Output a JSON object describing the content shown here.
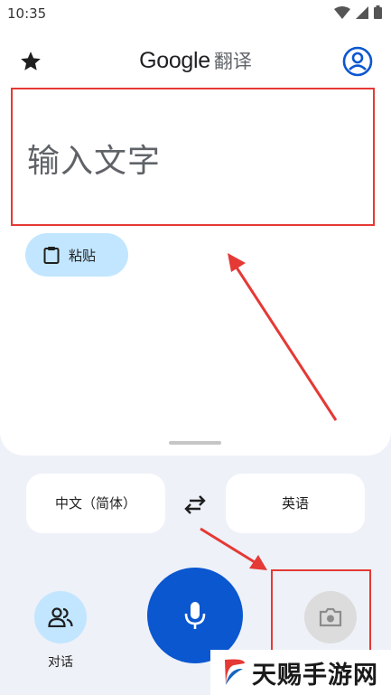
{
  "status_bar": {
    "time": "10:35"
  },
  "header": {
    "title_brand": "Google",
    "title_product": "翻译"
  },
  "input": {
    "placeholder": "输入文字"
  },
  "paste_button": {
    "label": "粘贴"
  },
  "languages": {
    "source": "中文（简体）",
    "target": "英语"
  },
  "actions": {
    "conversation_label": "对话"
  },
  "watermark": {
    "text": "天赐手游网"
  },
  "colors": {
    "accent": "#0b57d0",
    "chip": "#c2e6ff",
    "background": "#eef1f8",
    "highlight": "#e53935"
  },
  "icons": {
    "star": "star-icon",
    "account": "account-icon",
    "paste": "clipboard-icon",
    "swap": "swap-icon",
    "conversation": "people-icon",
    "mic": "mic-icon",
    "camera": "camera-icon"
  }
}
